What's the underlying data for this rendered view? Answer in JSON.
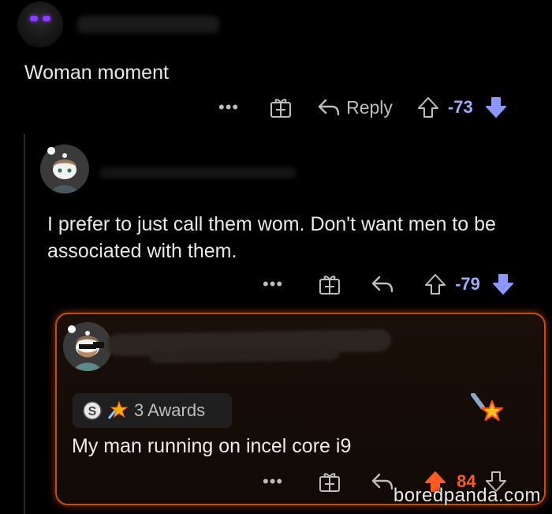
{
  "comment1": {
    "body": "Woman moment",
    "reply_label": "Reply",
    "score": "-73"
  },
  "comment2": {
    "body": "I prefer to just call them wom. Don't want men to be associated with them.",
    "score": "-79"
  },
  "comment3": {
    "awards_label": "3 Awards",
    "body": "My man running on incel core i9",
    "score": "84"
  },
  "watermark": "boredpanda.com",
  "colors": {
    "background": "#000000",
    "downvoted_score": "#a0a8ff",
    "upvoted_score": "#ff5a1f",
    "highlight_border": "#c44e12",
    "icon_gray": "#bdbdbd"
  },
  "icons": [
    "more-icon",
    "gift-award-icon",
    "reply-icon",
    "upvote-icon",
    "downvote-icon",
    "silver-award-icon",
    "starstruck-award-icon",
    "star-award-icon"
  ]
}
